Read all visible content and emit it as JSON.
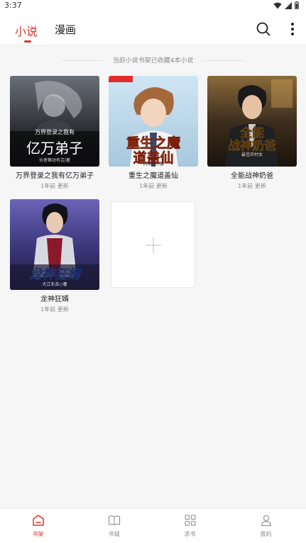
{
  "status_bar": {
    "time": "3:37"
  },
  "header": {
    "tabs": [
      {
        "label": "小说",
        "active": true
      },
      {
        "label": "漫画",
        "active": false
      }
    ]
  },
  "shelf": {
    "tip": "当前小说书架已收藏4本小说",
    "books": [
      {
        "title": "万界登录之我有亿万弟子",
        "updated": "1年前 更新"
      },
      {
        "title": "重生之魔道盖仙",
        "updated": "1年前 更新"
      },
      {
        "title": "全能战神奶爸",
        "updated": "1年前 更新"
      },
      {
        "title": "龙神狂婿",
        "updated": "1年前 更新"
      }
    ]
  },
  "covers": {
    "book1_lines": [
      "万界登录之我有",
      "亿万弟子",
      "长者舞动有芸|著"
    ],
    "book2_lines": [
      "重生之魔",
      "道盖仙",
      "白族猫○著"
    ],
    "book3_lines": [
      "全能",
      "战神奶爸",
      "最佳农村女"
    ],
    "book4_lines": [
      "龙神狂婿",
      "大江东去○著"
    ]
  },
  "bottom_nav": {
    "items": [
      {
        "label": "书架",
        "icon": "bookshelf-icon",
        "active": true
      },
      {
        "label": "书城",
        "icon": "open-book-icon",
        "active": false
      },
      {
        "label": "求书",
        "icon": "grid-icon",
        "active": false
      },
      {
        "label": "我的",
        "icon": "user-icon",
        "active": false
      }
    ]
  },
  "colors": {
    "accent": "#e0342d",
    "text": "#222222",
    "muted": "#888888",
    "background": "#f6f6f6"
  }
}
